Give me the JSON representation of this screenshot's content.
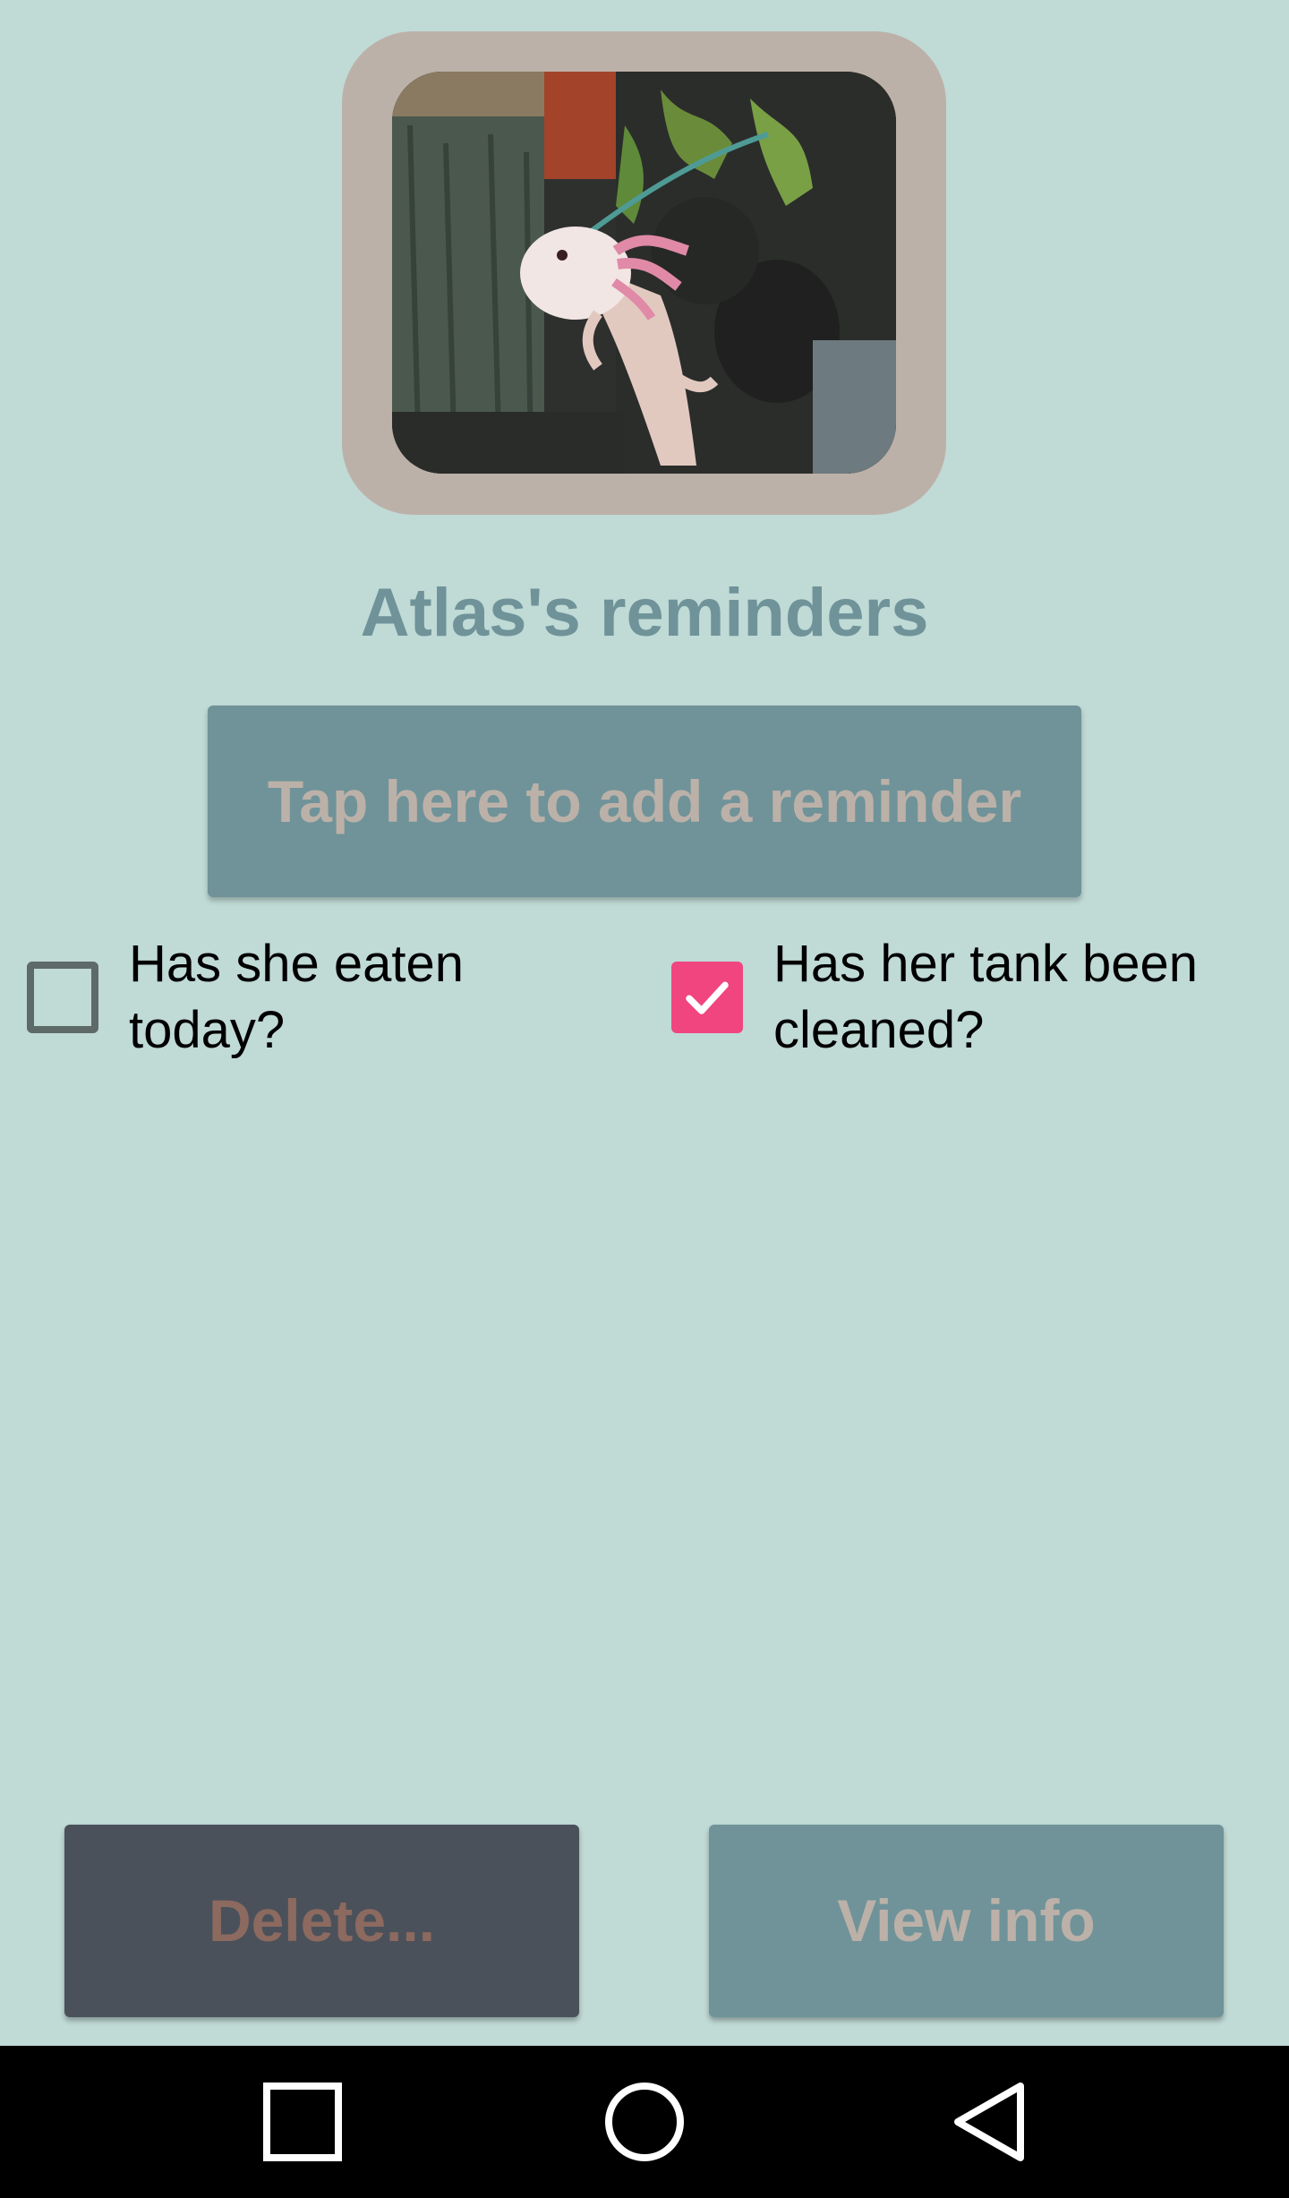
{
  "pet": {
    "photo_alt": "axolotl-photo"
  },
  "header": {
    "title": "Atlas's reminders"
  },
  "actions": {
    "add_reminder_label": "Tap here to add a reminder",
    "delete_label": "Delete...",
    "view_info_label": "View info"
  },
  "reminders": [
    {
      "label": "Has she eaten today?",
      "checked": false
    },
    {
      "label": "Has her tank been cleaned?",
      "checked": true
    }
  ],
  "colors": {
    "background": "#c0dad6",
    "accent": "#6f9399",
    "frame": "#bcb1a8",
    "checkbox_checked": "#f0457f",
    "delete_bg": "#4a515b",
    "delete_text": "#8c6a5f"
  },
  "navigation": {
    "recents_icon": "square-icon",
    "home_icon": "circle-icon",
    "back_icon": "triangle-back-icon"
  }
}
